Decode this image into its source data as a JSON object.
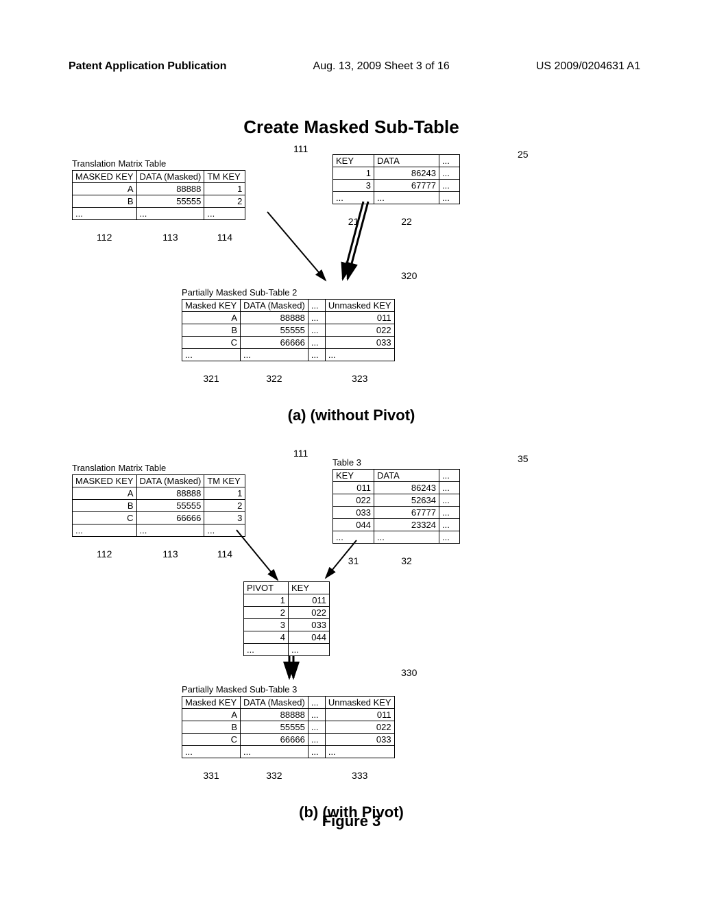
{
  "header": {
    "left": "Patent Application Publication",
    "mid": "Aug. 13, 2009  Sheet 3 of 16",
    "right": "US 2009/0204631 A1"
  },
  "main_title": "Create Masked Sub-Table",
  "section_a": {
    "tm": {
      "label": "Translation Matrix Table",
      "ref_top": "111",
      "headers": [
        "MASKED KEY",
        "DATA (Masked)",
        "TM KEY"
      ],
      "rows": [
        [
          "A",
          "88888",
          "1"
        ],
        [
          "B",
          "55555",
          "2"
        ],
        [
          "...",
          "...",
          "..."
        ]
      ],
      "refs": [
        "112",
        "113",
        "114"
      ]
    },
    "src": {
      "ref_side": "25",
      "headers": [
        "KEY",
        "DATA",
        "..."
      ],
      "rows": [
        [
          "1",
          "86243",
          "..."
        ],
        [
          "3",
          "67777",
          "..."
        ],
        [
          "...",
          "...",
          "..."
        ]
      ],
      "refs": [
        "21",
        "22"
      ]
    },
    "pm2": {
      "label": "Partially Masked Sub-Table 2",
      "ref_side": "320",
      "headers": [
        "Masked KEY",
        "DATA (Masked)",
        "...",
        "Unmasked KEY"
      ],
      "rows": [
        [
          "A",
          "88888",
          "...",
          "011"
        ],
        [
          "B",
          "55555",
          "...",
          "022"
        ],
        [
          "C",
          "66666",
          "...",
          "033"
        ],
        [
          "...",
          "...",
          "...",
          "..."
        ]
      ],
      "refs": [
        "321",
        "322",
        "323"
      ]
    },
    "caption": "(a) (without Pivot)"
  },
  "section_b": {
    "tm": {
      "label": "Translation Matrix Table",
      "ref_top": "111",
      "headers": [
        "MASKED KEY",
        "DATA (Masked)",
        "TM KEY"
      ],
      "rows": [
        [
          "A",
          "88888",
          "1"
        ],
        [
          "B",
          "55555",
          "2"
        ],
        [
          "C",
          "66666",
          "3"
        ],
        [
          "...",
          "...",
          "..."
        ]
      ],
      "refs": [
        "112",
        "113",
        "114"
      ]
    },
    "t3": {
      "label": "Table 3",
      "ref_side": "35",
      "headers": [
        "KEY",
        "DATA",
        "..."
      ],
      "rows": [
        [
          "011",
          "86243",
          "..."
        ],
        [
          "022",
          "52634",
          "..."
        ],
        [
          "033",
          "67777",
          "..."
        ],
        [
          "044",
          "23324",
          "..."
        ],
        [
          "...",
          "...",
          "..."
        ]
      ],
      "refs": [
        "31",
        "32"
      ]
    },
    "pivot": {
      "headers": [
        "PIVOT",
        "KEY"
      ],
      "rows": [
        [
          "1",
          "011"
        ],
        [
          "2",
          "022"
        ],
        [
          "3",
          "033"
        ],
        [
          "4",
          "044"
        ],
        [
          "...",
          "..."
        ]
      ]
    },
    "pm3": {
      "label": "Partially Masked Sub-Table 3",
      "ref_side": "330",
      "headers": [
        "Masked KEY",
        "DATA (Masked)",
        "...",
        "Unmasked KEY"
      ],
      "rows": [
        [
          "A",
          "88888",
          "...",
          "011"
        ],
        [
          "B",
          "55555",
          "...",
          "022"
        ],
        [
          "C",
          "66666",
          "...",
          "033"
        ],
        [
          "...",
          "...",
          "...",
          "..."
        ]
      ],
      "refs": [
        "331",
        "332",
        "333"
      ]
    },
    "caption": "(b) (with Pivot)"
  },
  "figure_caption": "Figure 3",
  "chart_data": {
    "type": "table",
    "tables": [
      {
        "name": "TranslationMatrix_a",
        "columns": [
          "MASKED KEY",
          "DATA (Masked)",
          "TM KEY"
        ],
        "rows": [
          [
            "A",
            "88888",
            "1"
          ],
          [
            "B",
            "55555",
            "2"
          ]
        ]
      },
      {
        "name": "Source_a",
        "columns": [
          "KEY",
          "DATA"
        ],
        "rows": [
          [
            "1",
            "86243"
          ],
          [
            "3",
            "67777"
          ]
        ]
      },
      {
        "name": "PartiallyMaskedSubTable2",
        "columns": [
          "Masked KEY",
          "DATA (Masked)",
          "Unmasked KEY"
        ],
        "rows": [
          [
            "A",
            "88888",
            "011"
          ],
          [
            "B",
            "55555",
            "022"
          ],
          [
            "C",
            "66666",
            "033"
          ]
        ]
      },
      {
        "name": "TranslationMatrix_b",
        "columns": [
          "MASKED KEY",
          "DATA (Masked)",
          "TM KEY"
        ],
        "rows": [
          [
            "A",
            "88888",
            "1"
          ],
          [
            "B",
            "55555",
            "2"
          ],
          [
            "C",
            "66666",
            "3"
          ]
        ]
      },
      {
        "name": "Table3",
        "columns": [
          "KEY",
          "DATA"
        ],
        "rows": [
          [
            "011",
            "86243"
          ],
          [
            "022",
            "52634"
          ],
          [
            "033",
            "67777"
          ],
          [
            "044",
            "23324"
          ]
        ]
      },
      {
        "name": "Pivot",
        "columns": [
          "PIVOT",
          "KEY"
        ],
        "rows": [
          [
            "1",
            "011"
          ],
          [
            "2",
            "022"
          ],
          [
            "3",
            "033"
          ],
          [
            "4",
            "044"
          ]
        ]
      },
      {
        "name": "PartiallyMaskedSubTable3",
        "columns": [
          "Masked KEY",
          "DATA (Masked)",
          "Unmasked KEY"
        ],
        "rows": [
          [
            "A",
            "88888",
            "011"
          ],
          [
            "B",
            "55555",
            "022"
          ],
          [
            "C",
            "66666",
            "033"
          ]
        ]
      }
    ],
    "title": "Create Masked Sub-Table"
  }
}
